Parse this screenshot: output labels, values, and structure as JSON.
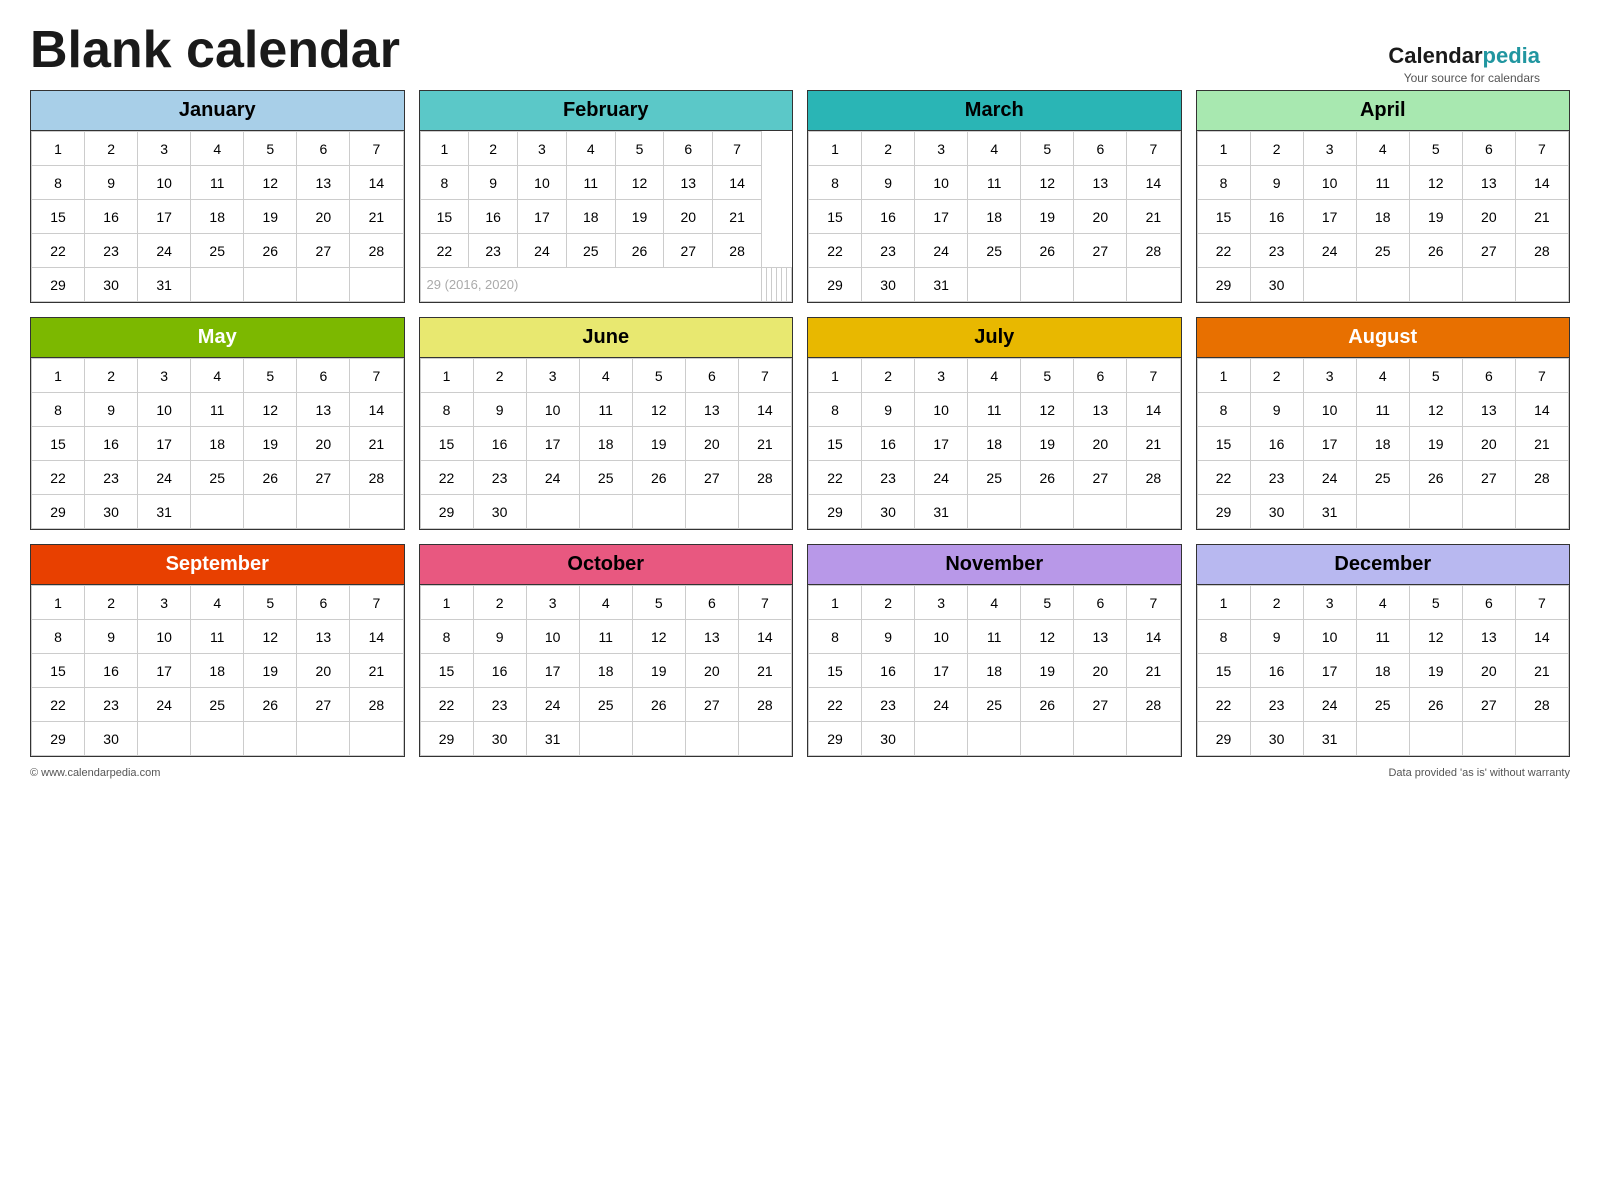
{
  "title": "Blank calendar",
  "brand": {
    "calendar": "Calendar",
    "pedia": "pedia",
    "tagline": "Your source for calendars"
  },
  "footer": {
    "left": "© www.calendarpedia.com",
    "right": "Data provided 'as is' without warranty"
  },
  "months": [
    {
      "id": "jan",
      "name": "January",
      "colorClass": "month-jan",
      "days": 31,
      "startDay": 1,
      "rows": [
        [
          1,
          2,
          3,
          4,
          5,
          6,
          7
        ],
        [
          8,
          9,
          10,
          11,
          12,
          13,
          14
        ],
        [
          15,
          16,
          17,
          18,
          19,
          20,
          21
        ],
        [
          22,
          23,
          24,
          25,
          26,
          27,
          28
        ],
        [
          29,
          30,
          31,
          null,
          null,
          null,
          null
        ]
      ]
    },
    {
      "id": "feb",
      "name": "February",
      "colorClass": "month-feb",
      "days": 28,
      "startDay": 3,
      "leapNote": "29  (2016, 2020)",
      "rows": [
        [
          1,
          2,
          3,
          4,
          5,
          6,
          7
        ],
        [
          8,
          9,
          10,
          11,
          12,
          13,
          14
        ],
        [
          15,
          16,
          17,
          18,
          19,
          20,
          21
        ],
        [
          22,
          23,
          24,
          25,
          26,
          27,
          28
        ],
        [
          "29*",
          null,
          null,
          null,
          null,
          null,
          null
        ]
      ]
    },
    {
      "id": "mar",
      "name": "March",
      "colorClass": "month-mar",
      "rows": [
        [
          1,
          2,
          3,
          4,
          5,
          6,
          7
        ],
        [
          8,
          9,
          10,
          11,
          12,
          13,
          14
        ],
        [
          15,
          16,
          17,
          18,
          19,
          20,
          21
        ],
        [
          22,
          23,
          24,
          25,
          26,
          27,
          28
        ],
        [
          29,
          30,
          31,
          null,
          null,
          null,
          null
        ]
      ]
    },
    {
      "id": "apr",
      "name": "April",
      "colorClass": "month-apr",
      "rows": [
        [
          1,
          2,
          3,
          4,
          5,
          6,
          7
        ],
        [
          8,
          9,
          10,
          11,
          12,
          13,
          14
        ],
        [
          15,
          16,
          17,
          18,
          19,
          20,
          21
        ],
        [
          22,
          23,
          24,
          25,
          26,
          27,
          28
        ],
        [
          29,
          30,
          null,
          null,
          null,
          null,
          null
        ]
      ]
    },
    {
      "id": "may",
      "name": "May",
      "colorClass": "month-may",
      "rows": [
        [
          1,
          2,
          3,
          4,
          5,
          6,
          7
        ],
        [
          8,
          9,
          10,
          11,
          12,
          13,
          14
        ],
        [
          15,
          16,
          17,
          18,
          19,
          20,
          21
        ],
        [
          22,
          23,
          24,
          25,
          26,
          27,
          28
        ],
        [
          29,
          30,
          31,
          null,
          null,
          null,
          null
        ]
      ]
    },
    {
      "id": "jun",
      "name": "June",
      "colorClass": "month-jun",
      "rows": [
        [
          1,
          2,
          3,
          4,
          5,
          6,
          7
        ],
        [
          8,
          9,
          10,
          11,
          12,
          13,
          14
        ],
        [
          15,
          16,
          17,
          18,
          19,
          20,
          21
        ],
        [
          22,
          23,
          24,
          25,
          26,
          27,
          28
        ],
        [
          29,
          30,
          null,
          null,
          null,
          null,
          null
        ]
      ]
    },
    {
      "id": "jul",
      "name": "July",
      "colorClass": "month-jul",
      "rows": [
        [
          1,
          2,
          3,
          4,
          5,
          6,
          7
        ],
        [
          8,
          9,
          10,
          11,
          12,
          13,
          14
        ],
        [
          15,
          16,
          17,
          18,
          19,
          20,
          21
        ],
        [
          22,
          23,
          24,
          25,
          26,
          27,
          28
        ],
        [
          29,
          30,
          31,
          null,
          null,
          null,
          null
        ]
      ]
    },
    {
      "id": "aug",
      "name": "August",
      "colorClass": "month-aug",
      "rows": [
        [
          1,
          2,
          3,
          4,
          5,
          6,
          7
        ],
        [
          8,
          9,
          10,
          11,
          12,
          13,
          14
        ],
        [
          15,
          16,
          17,
          18,
          19,
          20,
          21
        ],
        [
          22,
          23,
          24,
          25,
          26,
          27,
          28
        ],
        [
          29,
          30,
          31,
          null,
          null,
          null,
          null
        ]
      ]
    },
    {
      "id": "sep",
      "name": "September",
      "colorClass": "month-sep",
      "rows": [
        [
          1,
          2,
          3,
          4,
          5,
          6,
          7
        ],
        [
          8,
          9,
          10,
          11,
          12,
          13,
          14
        ],
        [
          15,
          16,
          17,
          18,
          19,
          20,
          21
        ],
        [
          22,
          23,
          24,
          25,
          26,
          27,
          28
        ],
        [
          29,
          30,
          null,
          null,
          null,
          null,
          null
        ]
      ]
    },
    {
      "id": "oct",
      "name": "October",
      "colorClass": "month-oct",
      "rows": [
        [
          1,
          2,
          3,
          4,
          5,
          6,
          7
        ],
        [
          8,
          9,
          10,
          11,
          12,
          13,
          14
        ],
        [
          15,
          16,
          17,
          18,
          19,
          20,
          21
        ],
        [
          22,
          23,
          24,
          25,
          26,
          27,
          28
        ],
        [
          29,
          30,
          31,
          null,
          null,
          null,
          null
        ]
      ]
    },
    {
      "id": "nov",
      "name": "November",
      "colorClass": "month-nov",
      "rows": [
        [
          1,
          2,
          3,
          4,
          5,
          6,
          7
        ],
        [
          8,
          9,
          10,
          11,
          12,
          13,
          14
        ],
        [
          15,
          16,
          17,
          18,
          19,
          20,
          21
        ],
        [
          22,
          23,
          24,
          25,
          26,
          27,
          28
        ],
        [
          29,
          30,
          null,
          null,
          null,
          null,
          null
        ]
      ]
    },
    {
      "id": "dec",
      "name": "December",
      "colorClass": "month-dec",
      "rows": [
        [
          1,
          2,
          3,
          4,
          5,
          6,
          7
        ],
        [
          8,
          9,
          10,
          11,
          12,
          13,
          14
        ],
        [
          15,
          16,
          17,
          18,
          19,
          20,
          21
        ],
        [
          22,
          23,
          24,
          25,
          26,
          27,
          28
        ],
        [
          29,
          30,
          31,
          null,
          null,
          null,
          null
        ]
      ]
    }
  ]
}
